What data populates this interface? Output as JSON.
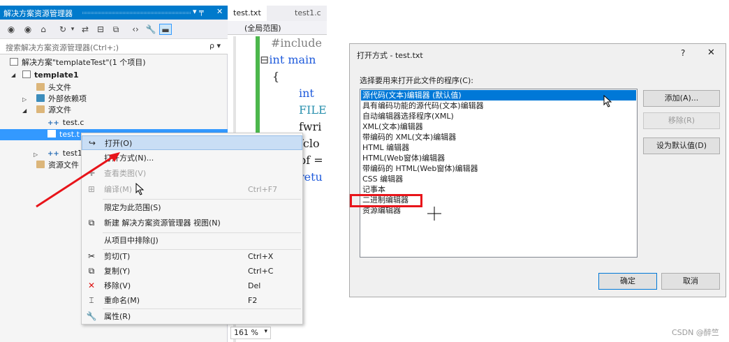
{
  "solution_explorer": {
    "title": "解决方案资源管理器",
    "pin_glyph": "▾ ╤",
    "close_glyph": "✕",
    "search_placeholder": "搜索解决方案资源管理器(Ctrl+;)",
    "search_icon": "ρ ▾",
    "tree": {
      "solution": "解决方案\"templateTest\"(1 个项目)",
      "project": "template1",
      "header_files": "头文件",
      "external_deps": "外部依赖项",
      "source_files": "源文件",
      "test_c": "test.c",
      "test_txt": "test.t",
      "test1": "test1",
      "resource_files": "资源文件"
    }
  },
  "context_menu": {
    "items": [
      {
        "label": "打开(O)",
        "shortcut": "",
        "icon": "open-icon",
        "glyph": "↪"
      },
      {
        "label": "打开方式(N)...",
        "shortcut": "",
        "icon": "",
        "glyph": ""
      },
      {
        "label": "查看类图(V)",
        "shortcut": "",
        "icon": "class-diagram-icon",
        "glyph": "✚"
      },
      {
        "label": "编译(M)",
        "shortcut": "Ctrl+F7",
        "icon": "compile-icon",
        "glyph": "⊞"
      },
      {
        "label": "限定为此范围(S)",
        "shortcut": "",
        "icon": "",
        "glyph": ""
      },
      {
        "label": "新建 解决方案资源管理器 视图(N)",
        "shortcut": "",
        "icon": "new-view-icon",
        "glyph": "⧉"
      },
      {
        "label": "从项目中排除(J)",
        "shortcut": "",
        "icon": "",
        "glyph": ""
      },
      {
        "label": "剪切(T)",
        "shortcut": "Ctrl+X",
        "icon": "cut-icon",
        "glyph": "✂"
      },
      {
        "label": "复制(Y)",
        "shortcut": "Ctrl+C",
        "icon": "copy-icon",
        "glyph": "⧉"
      },
      {
        "label": "移除(V)",
        "shortcut": "Del",
        "icon": "remove-icon",
        "glyph": "✕"
      },
      {
        "label": "重命名(M)",
        "shortcut": "F2",
        "icon": "rename-icon",
        "glyph": "⌶"
      },
      {
        "label": "属性(R)",
        "shortcut": "",
        "icon": "properties-icon",
        "glyph": "🔧"
      }
    ]
  },
  "editor": {
    "tabs": [
      "test.txt",
      "test1.c"
    ],
    "scope": "(全局范围)",
    "code_lines": [
      "#include",
      "int main",
      "{",
      "int",
      "FILE",
      "fwri",
      "fclo",
      "pf =",
      "retu"
    ],
    "zoom": "161 %",
    "zoom_arrow": "▾"
  },
  "dialog": {
    "title": "打开方式 - test.txt",
    "help_glyph": "?",
    "close_glyph": "✕",
    "prompt": "选择要用来打开此文件的程序(C):",
    "programs": [
      "源代码(文本)编辑器 (默认值)",
      "具有编码功能的源代码(文本)编辑器",
      "自动编辑器选择程序(XML)",
      "XML(文本)编辑器",
      "带编码的 XML(文本)编辑器",
      "HTML 编辑器",
      "HTML(Web窗体)编辑器",
      "带编码的 HTML(Web窗体)编辑器",
      "CSS 编辑器",
      "记事本",
      "二进制编辑器",
      "资源编辑器"
    ],
    "buttons": {
      "add": "添加(A)...",
      "remove": "移除(R)",
      "set_default": "设为默认值(D)",
      "ok": "确定",
      "cancel": "取消"
    }
  },
  "watermark": "CSDN @醉竺",
  "colors": {
    "accent": "#007acc",
    "highlight_box": "#e8141a",
    "annotation_arrow": "#e8141a",
    "selection": "#0078d7"
  }
}
